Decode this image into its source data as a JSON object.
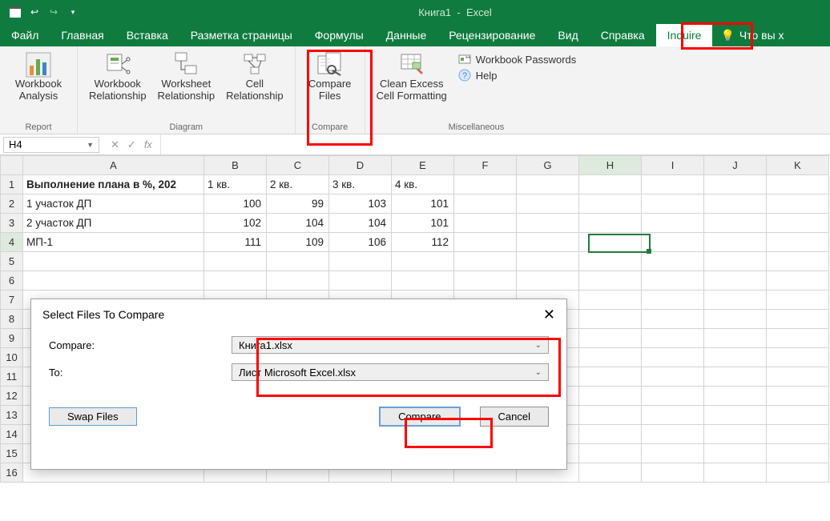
{
  "titlebar": {
    "doc_name": "Книга1",
    "app_name": "Excel"
  },
  "tabs": {
    "file": "Файл",
    "home": "Главная",
    "insert": "Вставка",
    "layout": "Разметка страницы",
    "formulas": "Формулы",
    "data": "Данные",
    "review": "Рецензирование",
    "view": "Вид",
    "help": "Справка",
    "inquire": "Inquire",
    "tellme": "Что вы х"
  },
  "ribbon": {
    "report": {
      "wb_analysis_l1": "Workbook",
      "wb_analysis_l2": "Analysis",
      "group": "Report"
    },
    "diagram": {
      "wb_rel_l1": "Workbook",
      "wb_rel_l2": "Relationship",
      "ws_rel_l1": "Worksheet",
      "ws_rel_l2": "Relationship",
      "cell_rel_l1": "Cell",
      "cell_rel_l2": "Relationship",
      "group": "Diagram"
    },
    "compare": {
      "cmp_l1": "Compare",
      "cmp_l2": "Files",
      "group": "Compare"
    },
    "misc": {
      "clean_l1": "Clean Excess",
      "clean_l2": "Cell Formatting",
      "pw": "Workbook Passwords",
      "help": "Help",
      "group": "Miscellaneous"
    }
  },
  "namebox": "H4",
  "columns": [
    "A",
    "B",
    "C",
    "D",
    "E",
    "F",
    "G",
    "H",
    "I",
    "J",
    "K"
  ],
  "rows": [
    "1",
    "2",
    "3",
    "4",
    "5",
    "6",
    "7",
    "8",
    "9",
    "10",
    "11",
    "12",
    "13",
    "14",
    "15",
    "16"
  ],
  "sheet": {
    "r1": {
      "A": "Выполнение плана в %, 202",
      "B": "1 кв.",
      "C": "2 кв.",
      "D": "3 кв.",
      "E": "4 кв."
    },
    "r2": {
      "A": "1 участок ДП",
      "B": "100",
      "C": "99",
      "D": "103",
      "E": "101"
    },
    "r3": {
      "A": "2 участок ДП",
      "B": "102",
      "C": "104",
      "D": "104",
      "E": "101"
    },
    "r4": {
      "A": "МП-1",
      "B": "111",
      "C": "109",
      "D": "106",
      "E": "112"
    }
  },
  "dialog": {
    "title": "Select Files To Compare",
    "compare_label": "Compare:",
    "to_label": "To:",
    "compare_value": "Книга1.xlsx",
    "to_value": "Лист Microsoft Excel.xlsx",
    "swap": "Swap Files",
    "compare_btn": "Compare",
    "cancel": "Cancel"
  },
  "active_cell": "H4"
}
